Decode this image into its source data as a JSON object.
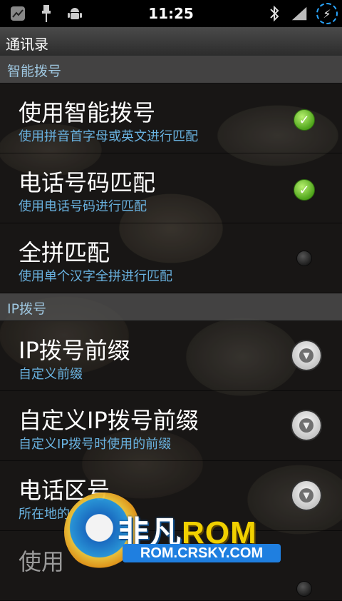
{
  "status_bar": {
    "time": "11:25",
    "left_icons": [
      "stocks-icon",
      "usb-icon",
      "android-debug-icon"
    ],
    "right_icons": [
      "bluetooth-icon",
      "signal-icon",
      "battery-charging-icon"
    ]
  },
  "title_bar": {
    "title": "通讯录"
  },
  "sections": {
    "smart_dial": {
      "header": "智能拨号",
      "items": [
        {
          "title": "使用智能拨号",
          "summary": "使用拼音首字母或英文进行匹配",
          "control": "checkbox",
          "checked": true
        },
        {
          "title": "电话号码匹配",
          "summary": "使用电话号码进行匹配",
          "control": "checkbox",
          "checked": true
        },
        {
          "title": "全拼匹配",
          "summary": "使用单个汉字全拼进行匹配",
          "control": "checkbox",
          "checked": false
        }
      ]
    },
    "ip_dial": {
      "header": "IP拨号",
      "items": [
        {
          "title": "IP拨号前缀",
          "summary": "自定义前缀",
          "control": "dropdown"
        },
        {
          "title": "自定义IP拨号前缀",
          "summary": "自定义IP拨号时使用的前缀",
          "control": "dropdown"
        },
        {
          "title": "电话区号",
          "summary": "所在地的                              ",
          "control": "dropdown"
        },
        {
          "title": "使用",
          "control": "checkbox",
          "checked": false
        }
      ]
    }
  },
  "watermark": {
    "brand_part1": "非凡",
    "brand_part2": "ROM",
    "site": "ROM.CRSKY.COM"
  },
  "colors": {
    "section_text": "#9fc7e0",
    "summary_text": "#69b2e0",
    "check_green": "#4fa51b",
    "battery_ring": "#2aa6ff"
  }
}
